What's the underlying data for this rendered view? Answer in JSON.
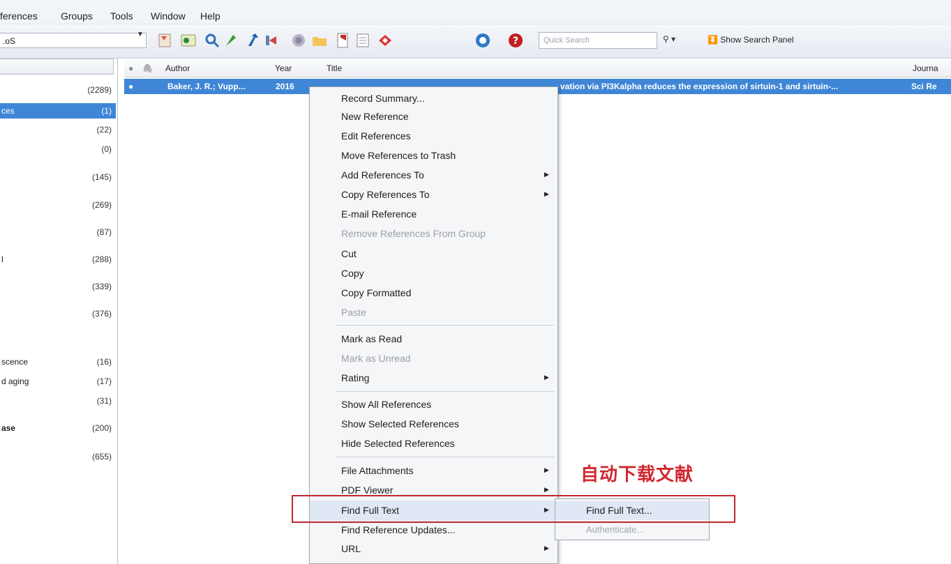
{
  "menubar": {
    "items": [
      "ferences",
      "Groups",
      "Tools",
      "Window",
      "Help"
    ]
  },
  "toolbar": {
    "style_value": ".oS",
    "quick_search_placeholder": "Quick Search",
    "show_search_panel": "Show Search Panel",
    "icons": [
      "online-search-icon",
      "import-icon",
      "find-icon",
      "insert-citation-icon",
      "export-icon",
      "back-icon",
      "globe-icon",
      "open-folder-icon",
      "pdf-icon",
      "format-icon",
      "share-icon",
      "sync-icon",
      "help-icon"
    ]
  },
  "groups": {
    "items": [
      {
        "name": "",
        "count": "(2289)"
      },
      {
        "name": "ces",
        "count": "(1)",
        "selected": true
      },
      {
        "name": "",
        "count": "(22)"
      },
      {
        "name": "",
        "count": "(0)"
      },
      {
        "name": "",
        "count": "(145)"
      },
      {
        "name": "",
        "count": "(269)"
      },
      {
        "name": "",
        "count": "(87)"
      },
      {
        "name": "l",
        "count": "(288)"
      },
      {
        "name": "",
        "count": "(339)"
      },
      {
        "name": "",
        "count": "(376)"
      },
      {
        "name": "scence",
        "count": "(16)"
      },
      {
        "name": "d aging",
        "count": "(17)"
      },
      {
        "name": "",
        "count": "(31)"
      },
      {
        "name": "ase",
        "count": "(200)"
      },
      {
        "name": "",
        "count": "(655)"
      }
    ]
  },
  "table": {
    "headers": {
      "author": "Author",
      "year": "Year",
      "title": "Title",
      "journal": "Journa"
    },
    "rows": [
      {
        "author": "Baker, J. R.; Vupp...",
        "year": "2016",
        "title": "vation via PI3Kalpha reduces the expression of sirtuin-1 and sirtuin-...",
        "journal": "Sci Re"
      }
    ]
  },
  "context_menu": {
    "items": [
      {
        "label": "Record Summary...",
        "enabled": true
      },
      {
        "label": "New Reference",
        "enabled": true
      },
      {
        "label": "Edit References",
        "enabled": true
      },
      {
        "label": "Move References to Trash",
        "enabled": true
      },
      {
        "label": "Add References To",
        "enabled": true,
        "submenu": true
      },
      {
        "label": "Copy References To",
        "enabled": true,
        "submenu": true
      },
      {
        "label": "E-mail Reference",
        "enabled": true
      },
      {
        "label": "Remove References From Group",
        "enabled": false
      },
      {
        "label": "Cut",
        "enabled": true
      },
      {
        "label": "Copy",
        "enabled": true
      },
      {
        "label": "Copy Formatted",
        "enabled": true
      },
      {
        "label": "Paste",
        "enabled": false
      },
      {
        "label": "Mark as Read",
        "enabled": true
      },
      {
        "label": "Mark as Unread",
        "enabled": false
      },
      {
        "label": "Rating",
        "enabled": true,
        "submenu": true
      },
      {
        "label": "Show All References",
        "enabled": true
      },
      {
        "label": "Show Selected References",
        "enabled": true
      },
      {
        "label": "Hide Selected References",
        "enabled": true
      },
      {
        "label": "File Attachments",
        "enabled": true,
        "submenu": true
      },
      {
        "label": "PDF Viewer",
        "enabled": true,
        "submenu": true
      },
      {
        "label": "Find Full Text",
        "enabled": true,
        "submenu": true,
        "highlighted": true
      },
      {
        "label": "Find Reference Updates...",
        "enabled": true
      },
      {
        "label": "URL",
        "enabled": true,
        "submenu": true
      }
    ]
  },
  "submenu": {
    "items": [
      {
        "label": "Find Full Text...",
        "enabled": true,
        "highlighted": true
      },
      {
        "label": "Authenticate...",
        "enabled": false
      }
    ]
  },
  "annotation": {
    "note": "自动下载文献",
    "color": "#d1272f"
  }
}
